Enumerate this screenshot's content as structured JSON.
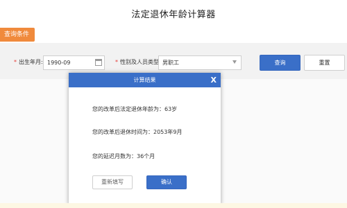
{
  "page_title": "法定退休年龄计算器",
  "section_tab": "查询条件",
  "form": {
    "birth_label": "出生年月:",
    "birth_value": "1990-09",
    "category_label": "性别及人员类型:",
    "category_value": "男职工",
    "query_button": "查询",
    "reset_button": "重置"
  },
  "modal": {
    "title": "计算结果",
    "close": "X",
    "line1": "您的改革后法定退休年龄为：63岁",
    "line2": "您的改革后退休时间为：2053年9月",
    "line3": "您的延迟月数为：36个月",
    "refill_button": "重新填写",
    "confirm_button": "确认"
  },
  "colors": {
    "accent_blue": "#3a6fc8",
    "tab_orange": "#f08a3c",
    "required_red": "#e53935"
  },
  "icons": [
    "calendar-icon",
    "chevron-down-icon",
    "close-icon"
  ]
}
